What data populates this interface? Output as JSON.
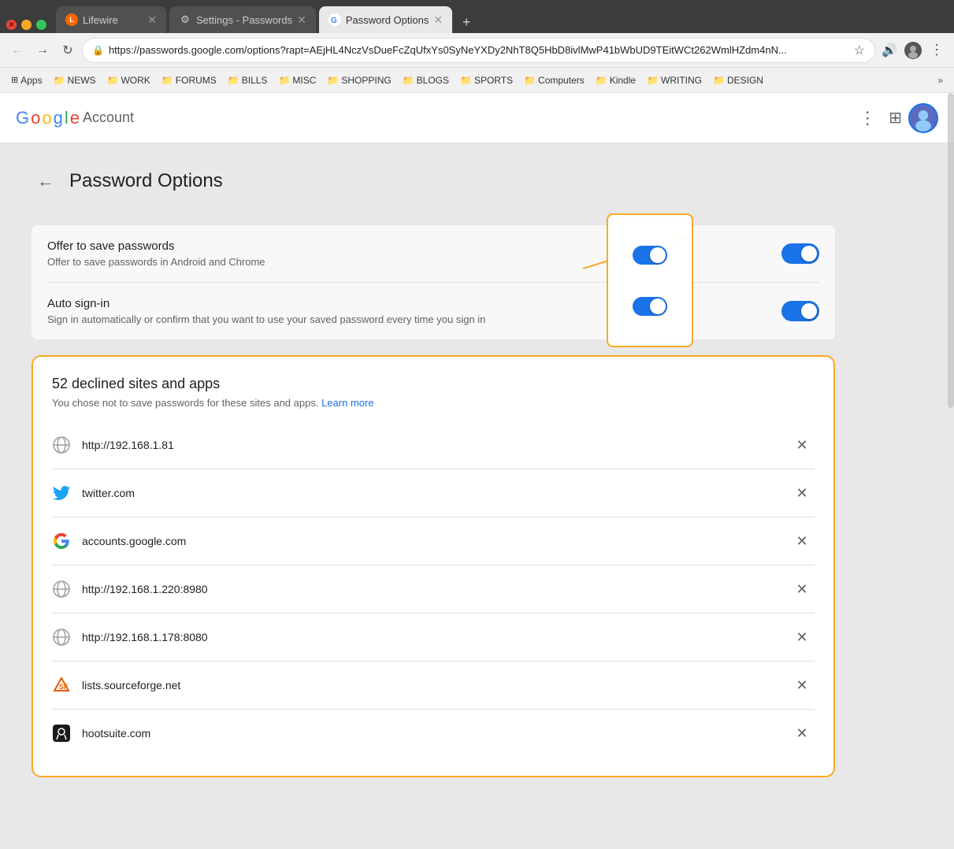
{
  "browser": {
    "tabs": [
      {
        "id": "lifewire",
        "label": "Lifewire",
        "icon": "L",
        "icon_color": "#ff6600",
        "active": false
      },
      {
        "id": "settings-passwords",
        "label": "Settings - Passwords",
        "icon": "⚙",
        "icon_color": "#1a73e8",
        "active": false
      },
      {
        "id": "password-options",
        "label": "Password Options",
        "icon": "G",
        "icon_color": "#4285f4",
        "active": true
      }
    ],
    "address": "https://passwords.google.com/options?rapt=AEjHL4NczVsDueFcZqUfxYs0SyNeYXDy2NhT8Q5HbD8ivlMwP41bWbUD9TEitWCt262WmlHZdm4nN...",
    "bookmarks": [
      {
        "label": "Apps",
        "has_icon": true
      },
      {
        "label": "NEWS",
        "has_folder": true
      },
      {
        "label": "WORK",
        "has_folder": true
      },
      {
        "label": "FORUMS",
        "has_folder": true
      },
      {
        "label": "BILLS",
        "has_folder": true
      },
      {
        "label": "MISC",
        "has_folder": true
      },
      {
        "label": "SHOPPING",
        "has_folder": true
      },
      {
        "label": "BLOGS",
        "has_folder": true
      },
      {
        "label": "SPORTS",
        "has_folder": true
      },
      {
        "label": "Computers",
        "has_folder": true
      },
      {
        "label": "Kindle",
        "has_folder": true
      },
      {
        "label": "WRITING",
        "has_folder": true
      },
      {
        "label": "DESIGN",
        "has_folder": true
      }
    ]
  },
  "header": {
    "google_text": "Google",
    "account_text": "Account"
  },
  "page": {
    "back_label": "←",
    "title": "Password Options",
    "settings": [
      {
        "id": "offer-save",
        "title": "Offer to save passwords",
        "description": "Offer to save passwords in Android and Chrome",
        "enabled": true
      },
      {
        "id": "auto-signin",
        "title": "Auto sign-in",
        "description": "Sign in automatically or confirm that you want to use your saved password every time you sign in",
        "enabled": true
      }
    ],
    "declined_section": {
      "title": "52 declined sites and apps",
      "description": "You chose not to save passwords for these sites and apps.",
      "learn_more_label": "Learn more",
      "sites": [
        {
          "id": "site-1",
          "name": "http://192.168.1.81",
          "type": "globe"
        },
        {
          "id": "site-2",
          "name": "twitter.com",
          "type": "twitter"
        },
        {
          "id": "site-3",
          "name": "accounts.google.com",
          "type": "google"
        },
        {
          "id": "site-4",
          "name": "http://192.168.1.220:8980",
          "type": "globe"
        },
        {
          "id": "site-5",
          "name": "http://192.168.1.178:8080",
          "type": "globe"
        },
        {
          "id": "site-6",
          "name": "lists.sourceforge.net",
          "type": "sourceforge"
        },
        {
          "id": "site-7",
          "name": "hootsuite.com",
          "type": "hootsuite"
        }
      ]
    }
  }
}
